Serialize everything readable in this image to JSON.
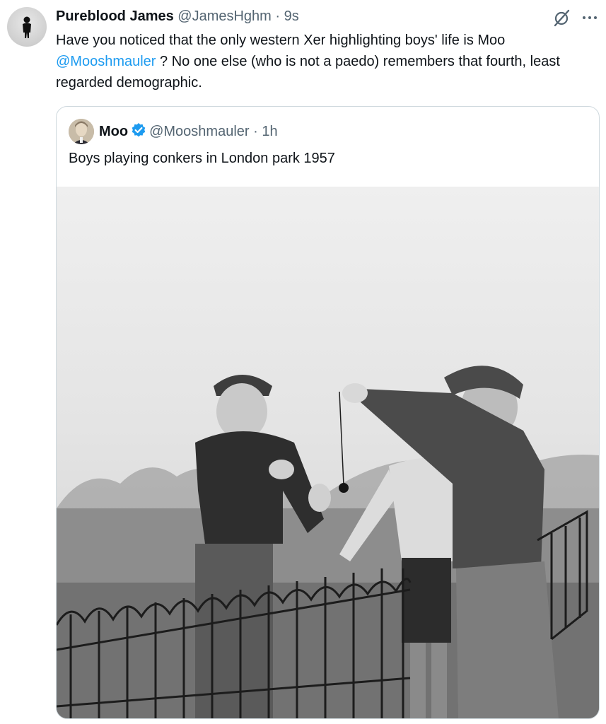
{
  "tweet": {
    "author_name": "Pureblood James",
    "author_handle": "@JamesHghm",
    "separator": "·",
    "timestamp": "9s",
    "text_part1": "Have you noticed that the only western Xer highlighting boys' life is Moo",
    "mention": "@Mooshmauler",
    "text_part2": " ?  No one else (who is not a paedo) remembers that fourth, least regarded demographic."
  },
  "quoted_tweet": {
    "author_name": "Moo",
    "author_handle": "@Mooshmauler",
    "separator": "·",
    "timestamp": "1h",
    "text": "Boys playing conkers in London park 1957",
    "verified": true,
    "photo": "black-and-white photo of boys playing conkers by a park railing"
  },
  "icons": [
    "grok-icon",
    "more-options-icon",
    "verified-badge-icon"
  ],
  "colors": {
    "text": "#0f1419",
    "secondary": "#536471",
    "link": "#1d9bf0",
    "border": "#cfd9de"
  }
}
